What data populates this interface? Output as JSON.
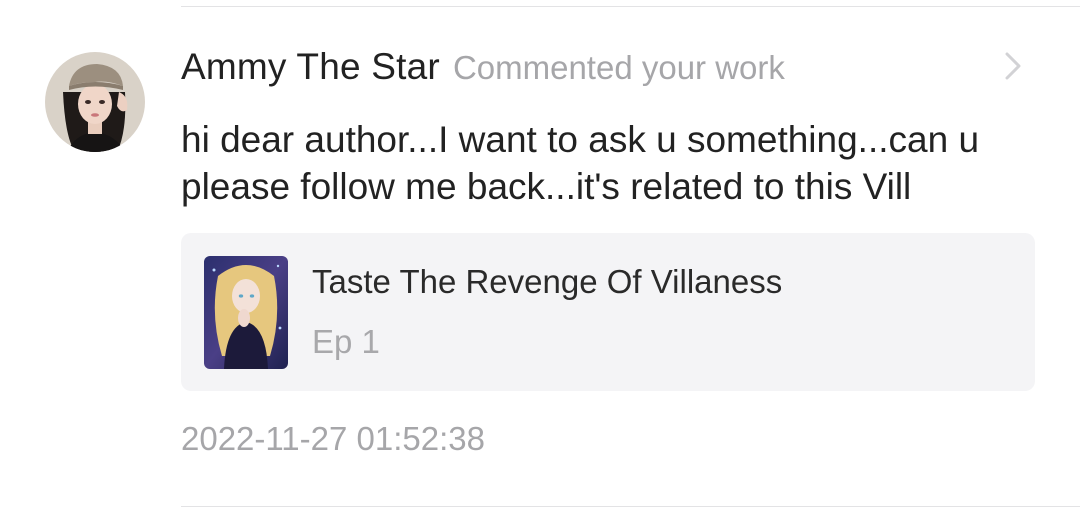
{
  "notification": {
    "user": {
      "name": "Ammy The Star",
      "avatar": "user-avatar"
    },
    "action_text": "Commented your work",
    "chevron_icon": "chevron-right-icon",
    "comment": "hi dear author...I want to ask u something...can u please follow me back...it's related to this Vill",
    "work": {
      "title": "Taste The Revenge Of Villaness",
      "episode": "Ep 1",
      "cover": "book-cover-image"
    },
    "timestamp": "2022-11-27 01:52:38"
  },
  "colors": {
    "primary_text": "#222222",
    "secondary_text": "#a6a6a9",
    "card_background": "#f4f4f6",
    "divider": "#e3e3e5"
  }
}
